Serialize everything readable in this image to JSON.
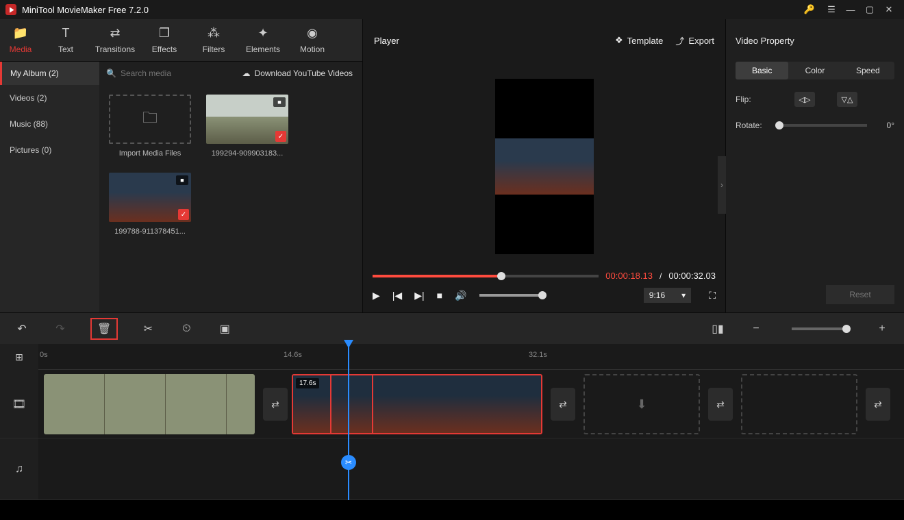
{
  "title": "MiniTool MovieMaker Free 7.2.0",
  "toolbar": [
    {
      "label": "Media",
      "icon": "folder"
    },
    {
      "label": "Text",
      "icon": "text"
    },
    {
      "label": "Transitions",
      "icon": "arrows"
    },
    {
      "label": "Effects",
      "icon": "layers"
    },
    {
      "label": "Filters",
      "icon": "sliders"
    },
    {
      "label": "Elements",
      "icon": "sparkle"
    },
    {
      "label": "Motion",
      "icon": "motion"
    }
  ],
  "sidebar_head": "My Album (2)",
  "search_placeholder": "Search media",
  "download_label": "Download YouTube Videos",
  "side_items": [
    "Videos (2)",
    "Music (88)",
    "Pictures (0)"
  ],
  "media": [
    {
      "type": "import",
      "label": "Import Media Files"
    },
    {
      "type": "video",
      "label": "199294-909903183...",
      "kind": "river"
    },
    {
      "type": "video",
      "label": "199788-911378451...",
      "kind": "smoke"
    }
  ],
  "player": {
    "title": "Player",
    "template": "Template",
    "export": "Export",
    "current": "00:00:18.13",
    "total": "00:00:32.03",
    "ratio": "9:16"
  },
  "prop": {
    "title": "Video Property",
    "tabs": [
      "Basic",
      "Color",
      "Speed"
    ],
    "flip": "Flip:",
    "rotate": "Rotate:",
    "rotate_val": "0°",
    "reset": "Reset"
  },
  "ruler": {
    "t0": "0s",
    "t1": "14.6s",
    "t2": "32.1s"
  },
  "clip_duration": "17.6s"
}
